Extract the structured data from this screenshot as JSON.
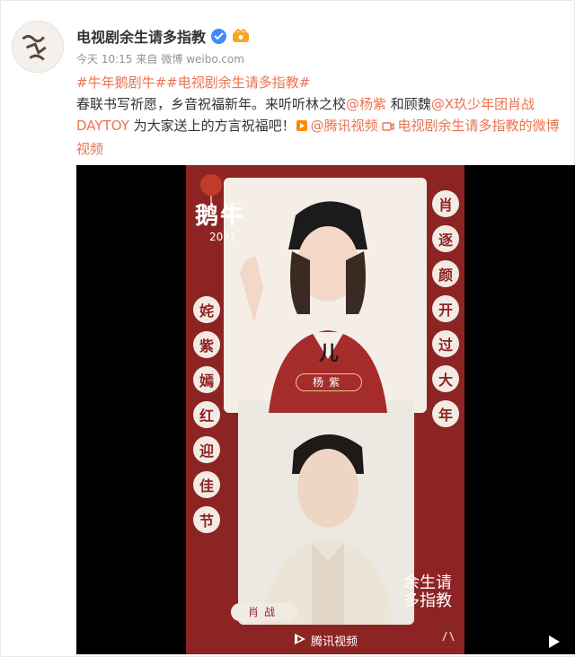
{
  "post": {
    "account_name": "电视剧余生请多指教",
    "time": "今天 10:15",
    "from_label": "来自",
    "source": "微博 weibo.com",
    "topic_1": "#牛年鹅剧牛#",
    "topic_2": "#电视剧余生请多指教#",
    "text_1": "春联书写祈愿，乡音祝福新年。来听听林之校",
    "mention_1": "@杨紫",
    "text_2": " 和顾魏",
    "mention_2": "@X玖少年团肖战DAYTOY",
    "text_3": " 为大家送上的方言祝福吧！",
    "mention_3": "@腾讯视频",
    "video_link": "电视剧余生请多指教的微博视频"
  },
  "video": {
    "logo_text": "鹅牛",
    "year": "2021",
    "left_couplet": [
      "姹",
      "紫",
      "嫣",
      "红",
      "迎",
      "佳",
      "节"
    ],
    "right_couplet": [
      "肖",
      "逐",
      "颜",
      "开",
      "过",
      "大",
      "年"
    ],
    "caption_char": "儿",
    "name_tag_1": "杨紫",
    "name_tag_2": "肖战",
    "platform_text": "腾讯视频",
    "title_art": "余生请多指教"
  },
  "colors": {
    "accent": "#eb7350",
    "poster_red": "#8d2424",
    "gold": "#e9c98a"
  }
}
